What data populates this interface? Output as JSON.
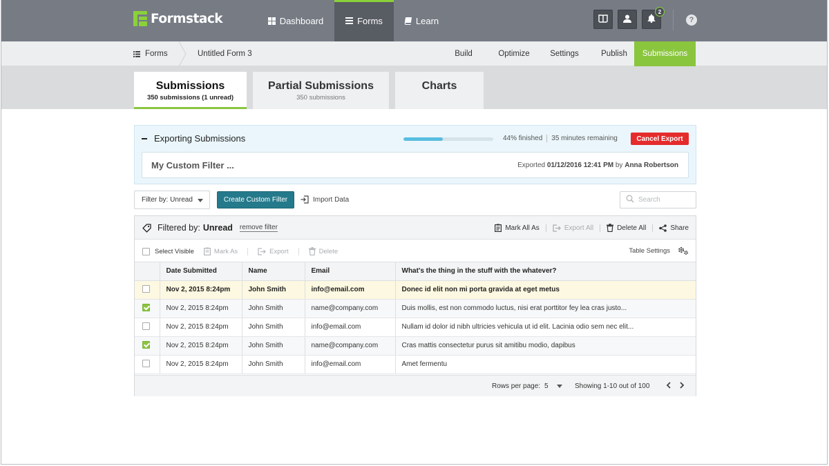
{
  "app": {
    "brand": "Formstack",
    "accent": "#8ac53e",
    "primary": "#247a8b",
    "danger": "#e52b2b"
  },
  "topnav": [
    {
      "label": "Dashboard",
      "icon": "grid-icon"
    },
    {
      "label": "Forms",
      "icon": "list-icon",
      "active": true
    },
    {
      "label": "Learn",
      "icon": "book-icon"
    }
  ],
  "topright": {
    "notifications_count": "2",
    "help": "?"
  },
  "breadcrumb": {
    "root": "Forms",
    "current": "Untitled Form 3"
  },
  "subnav": [
    {
      "label": "Build"
    },
    {
      "label": "Optimize"
    },
    {
      "label": "Settings"
    },
    {
      "label": "Publish"
    },
    {
      "label": "Submissions",
      "active": true
    }
  ],
  "tabs": [
    {
      "title": "Submissions",
      "sub": "350 submissions (1 unread)",
      "active": true
    },
    {
      "title": "Partial Submissions",
      "sub": "350 submissions"
    },
    {
      "title": "Charts",
      "sub": ""
    }
  ],
  "export": {
    "title": "Exporting Submissions",
    "progress_percent": 44,
    "progress_label": "44% finished",
    "remaining": "35 minutes remaining",
    "cancel_label": "Cancel Export",
    "filter_name": "My Custom Filter ...",
    "meta_prefix": "Exported",
    "meta_date": "01/12/2016 12:41 PM",
    "meta_by": "by",
    "meta_user": "Anna Robertson"
  },
  "toolbar": {
    "filter_select": "Filter by: Unread",
    "create_filter": "Create Custom Filter",
    "import": "Import Data",
    "search_placeholder": "Search"
  },
  "filter_head": {
    "prefix": "Filtered by:",
    "value": "Unread",
    "remove": "remove filter",
    "mark_all": "Mark All As",
    "export_all": "Export All",
    "delete_all": "Delete All",
    "share": "Share"
  },
  "bulk": {
    "select_visible": "Select Visible",
    "mark_as": "Mark As",
    "export": "Export",
    "delete": "Delete",
    "table_settings": "Table Settings"
  },
  "table": {
    "columns": [
      "Date Submitted",
      "Name",
      "Email",
      "What's the thing in the stuff with the whatever?"
    ],
    "rows": [
      {
        "checked": false,
        "unread": true,
        "cells": [
          "Nov 2, 2015 8:24pm",
          "John Smith",
          "info@email.com",
          "Donec id elit non mi porta gravida at eget metus"
        ]
      },
      {
        "checked": true,
        "unread": false,
        "cells": [
          "Nov 2, 2015 8:24pm",
          "John Smith",
          "name@company.com",
          "Duis mollis, est non commodo luctus, nisi erat porttitor fey lea cras justo..."
        ]
      },
      {
        "checked": false,
        "unread": false,
        "cells": [
          "Nov 2, 2015 8:24pm",
          "John Smith",
          "info@email.com",
          "Nullam id dolor id nibh ultricies vehicula ut id elit. Lacinia odio sem nec elit..."
        ]
      },
      {
        "checked": true,
        "unread": false,
        "cells": [
          "Nov 2, 2015 8:24pm",
          "John Smith",
          "name@company.com",
          "Cras mattis consectetur purus sit amitibu modio, dapibus"
        ]
      },
      {
        "checked": false,
        "unread": false,
        "cells": [
          "Nov 2, 2015 8:24pm",
          "John Smith",
          "info@email.com",
          "Amet fermentu"
        ]
      }
    ]
  },
  "pager": {
    "rows_label": "Rows per page:",
    "rows_value": "5",
    "showing": "Showing 1-10 out of 100"
  }
}
